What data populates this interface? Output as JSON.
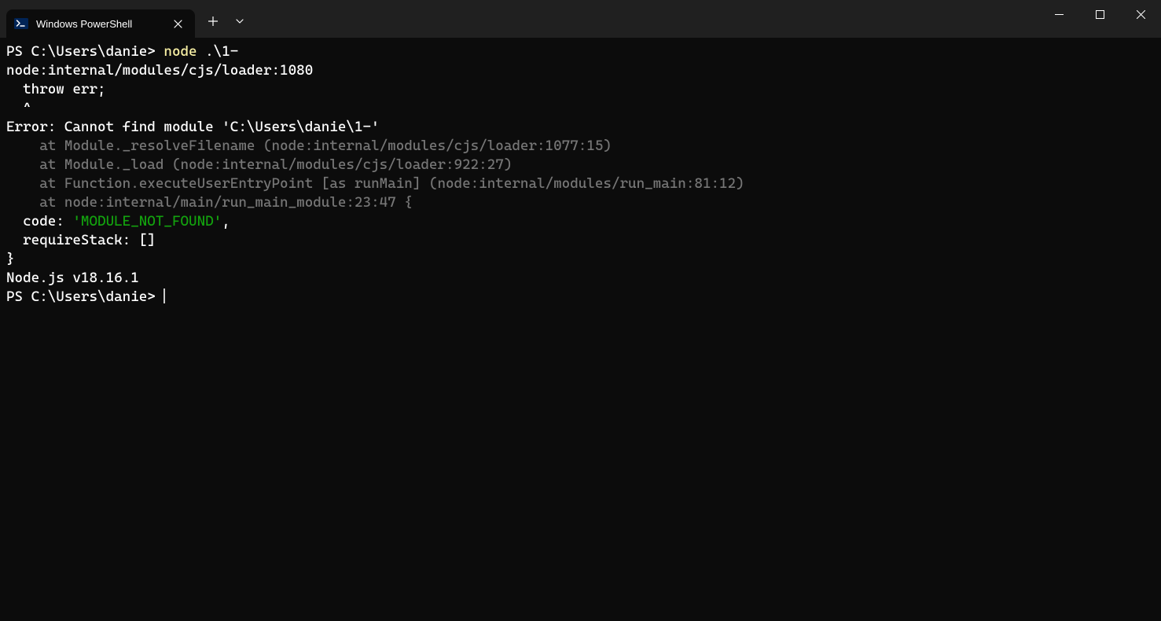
{
  "tab": {
    "title": "Windows PowerShell"
  },
  "terminal": {
    "line1_prompt": "PS C:\\Users\\danie> ",
    "line1_cmd": "node ",
    "line1_arg": ".\\1-",
    "line2": "node:internal/modules/cjs/loader:1080",
    "line3": "  throw err;",
    "line4": "  ^",
    "line5": "",
    "line6": "Error: Cannot find module 'C:\\Users\\danie\\1-'",
    "line7": "    at Module._resolveFilename (node:internal/modules/cjs/loader:1077:15)",
    "line8": "    at Module._load (node:internal/modules/cjs/loader:922:27)",
    "line9": "    at Function.executeUserEntryPoint [as runMain] (node:internal/modules/run_main:81:12)",
    "line10": "    at node:internal/main/run_main_module:23:47 {",
    "line11_a": "  code: ",
    "line11_b": "'MODULE_NOT_FOUND'",
    "line11_c": ",",
    "line12": "  requireStack: []",
    "line13": "}",
    "line14": "",
    "line15": "Node.js v18.16.1",
    "line16": "PS C:\\Users\\danie> "
  }
}
